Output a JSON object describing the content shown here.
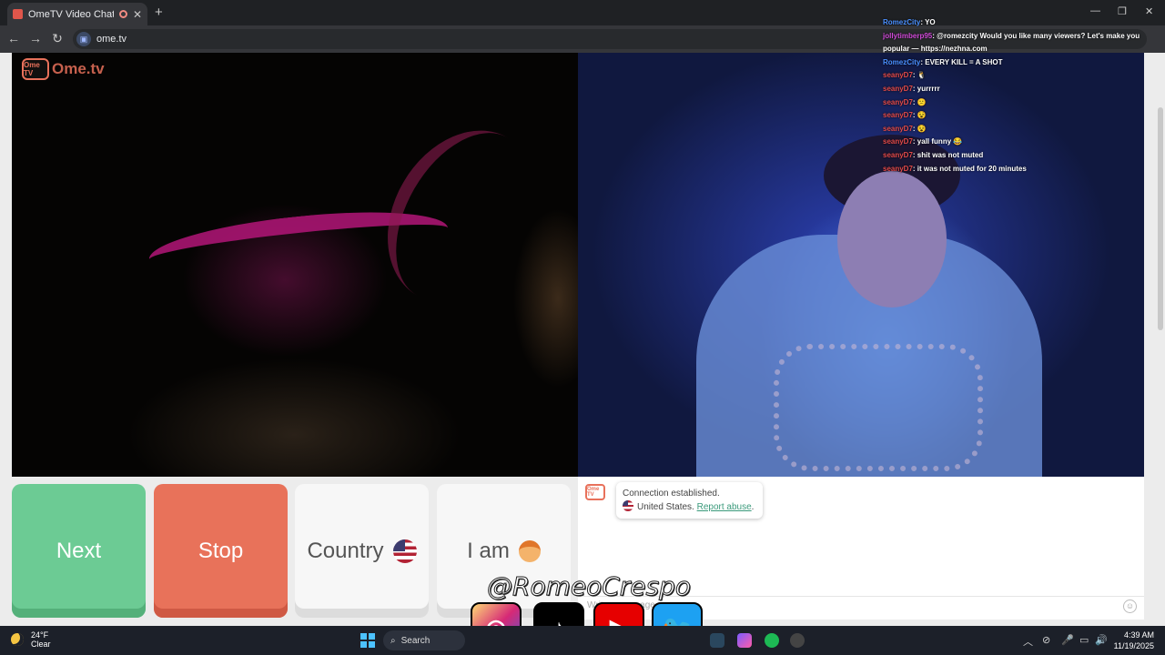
{
  "browser": {
    "tab_title": "OmeTV Video Chat — Ome",
    "tab_close": "✕",
    "new_tab": "+",
    "url": "ome.tv",
    "back": "←",
    "forward": "→",
    "reload": "↻",
    "win_min": "—",
    "win_max": "❐",
    "win_close": "✕"
  },
  "site": {
    "logo_badge": "Ome TV",
    "logo_text": "Ome.tv"
  },
  "chat_overlay": [
    {
      "user": "RomezCity",
      "msg": ": YO",
      "cls": "u"
    },
    {
      "user": "jollytimberp95",
      "msg": ": @romezcity Would you like many viewers? Let's make you popular — https://nezhna.com",
      "cls": "u3"
    },
    {
      "user": "RomezCity",
      "msg": ": EVERY KILL = A SHOT",
      "cls": "u"
    },
    {
      "user": "seanyD7",
      "msg": ": 🐧",
      "cls": "u2"
    },
    {
      "user": "seanyD7",
      "msg": ": yurrrrr",
      "cls": "u2"
    },
    {
      "user": "seanyD7",
      "msg": ": 😕",
      "cls": "u2"
    },
    {
      "user": "seanyD7",
      "msg": ": 😵",
      "cls": "u2"
    },
    {
      "user": "seanyD7",
      "msg": ": 😵",
      "cls": "u2"
    },
    {
      "user": "seanyD7",
      "msg": ": yall funny 😂",
      "cls": "u2"
    },
    {
      "user": "seanyD7",
      "msg": ": shit was not muted",
      "cls": "u2"
    },
    {
      "user": "seanyD7",
      "msg": ": it was not muted for 20 minutes",
      "cls": "u2"
    }
  ],
  "controls": {
    "next": "Next",
    "stop": "Stop",
    "country": "Country",
    "iam": "I am"
  },
  "chat": {
    "badge": "Ome TV",
    "status": "Connection established.",
    "country": "United States.",
    "report": "Report abuse",
    "period": ".",
    "input_placeholder": "Write a message...",
    "emoji": "☺"
  },
  "watermark": "@RomeoCrespo",
  "social": {
    "instagram": "◎",
    "tiktok": "♪",
    "youtube": "▶",
    "twitter": "🐦"
  },
  "taskbar": {
    "temp": "24°F",
    "condition": "Clear",
    "search": "Search",
    "time": "4:39 AM",
    "date": "11/19/2025",
    "tray_up": "︿",
    "tray_wifi": "📶",
    "tray_mic": "🎤",
    "tray_vol": "🔊"
  },
  "colors": {
    "next": "#6ccb94",
    "stop": "#e8725a",
    "brand": "#e8715b",
    "link": "#3a9a7b"
  }
}
